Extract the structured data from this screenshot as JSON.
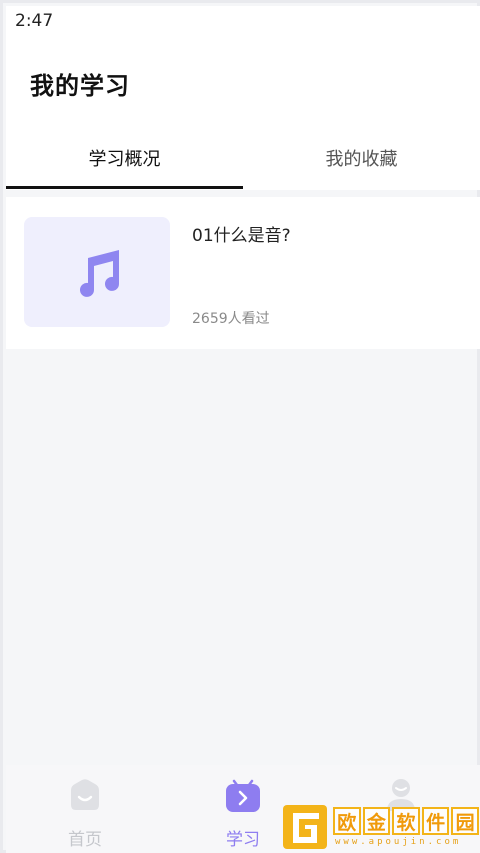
{
  "status_bar": {
    "time": "2:47"
  },
  "header": {
    "title": "我的学习"
  },
  "tabs": [
    {
      "label": "学习概况",
      "active": true
    },
    {
      "label": "我的收藏",
      "active": false
    }
  ],
  "course_list": [
    {
      "title": "01什么是音?",
      "views": "2659人看过",
      "thumb_icon": "music-note-icon"
    }
  ],
  "bottom_nav": [
    {
      "label": "首页",
      "icon": "home-icon",
      "active": false
    },
    {
      "label": "学习",
      "icon": "study-icon",
      "active": true
    },
    {
      "label": "",
      "icon": "profile-icon",
      "active": false
    }
  ],
  "watermark": {
    "chars": [
      "欧",
      "金",
      "软",
      "件",
      "园"
    ],
    "url": "www.apoujin.com"
  },
  "colors": {
    "accent": "#8e7df0",
    "thumb_bg": "#efeffd",
    "page_bg": "#f5f6f8",
    "inactive_nav": "#c5c7cc",
    "watermark": "#f3b419"
  }
}
